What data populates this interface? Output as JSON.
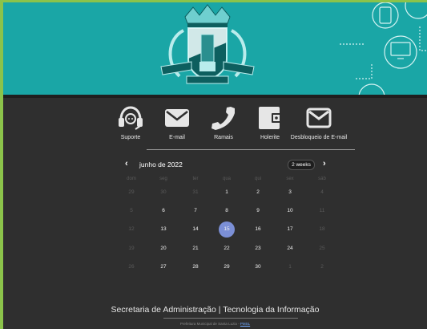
{
  "nav": {
    "items": [
      {
        "label": "Suporte",
        "icon": "headset-icon"
      },
      {
        "label": "E-mail",
        "icon": "mail-icon"
      },
      {
        "label": "Ramais",
        "icon": "phone-icon"
      },
      {
        "label": "Holerite",
        "icon": "wallet-icon"
      },
      {
        "label": "Desbloqueio de E-mail",
        "icon": "mail-outline-icon"
      }
    ]
  },
  "calendar": {
    "month": "junho de 2022",
    "period": "2 weeks",
    "weekdays": [
      "dom",
      "seg",
      "ter",
      "qua",
      "qui",
      "sex",
      "sáb"
    ],
    "weeks": [
      [
        "29",
        "30",
        "31",
        "1",
        "2",
        "3",
        "4"
      ],
      [
        "5",
        "6",
        "7",
        "8",
        "9",
        "10",
        "11"
      ],
      [
        "12",
        "13",
        "14",
        "15",
        "16",
        "17",
        "18"
      ],
      [
        "19",
        "20",
        "21",
        "22",
        "23",
        "24",
        "25"
      ],
      [
        "26",
        "27",
        "28",
        "29",
        "30",
        "1",
        "2"
      ]
    ],
    "today": "15",
    "today_color": "#7b8fd6"
  },
  "footer": {
    "title": "Secretaria de Administração | Tecnologia da Informação",
    "subtitle": "Prefeitura Municipal de Santa Luzia - ",
    "subtitle_link": "PMSL"
  },
  "colors": {
    "banner": "#1aa6a6",
    "background": "#2f2f2f",
    "outer": "#8bc34a"
  }
}
